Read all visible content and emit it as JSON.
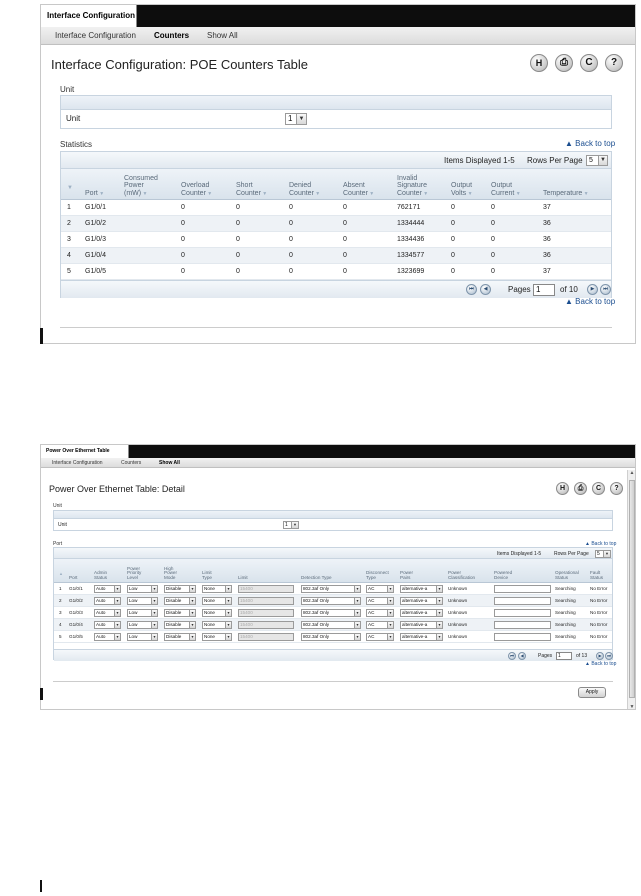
{
  "shot1": {
    "top_tab": "Interface Configuration",
    "subnav": [
      "Interface Configuration",
      "Counters",
      "Show All"
    ],
    "title": "Interface Configuration: POE Counters Table",
    "icons": {
      "save": "H",
      "print": "⎙",
      "refresh": "C",
      "help": "?"
    },
    "unit_section": "Unit",
    "unit_label": "Unit",
    "unit_value": "1",
    "stats_section": "Statistics",
    "back_to_top": "Back to top",
    "items_displayed": "Items Displayed 1-5",
    "rows_per_page_label": "Rows Per Page",
    "rows_per_page_value": "5",
    "columns": [
      [
        "",
        "Port"
      ],
      [
        "Consumed",
        "Power",
        "(mW)"
      ],
      [
        "Overload",
        "Counter"
      ],
      [
        "Short",
        "Counter"
      ],
      [
        "Denied",
        "Counter"
      ],
      [
        "Absent",
        "Counter"
      ],
      [
        "Invalid",
        "Signature",
        "Counter"
      ],
      [
        "Output",
        "Volts"
      ],
      [
        "Output",
        "Current"
      ],
      [
        "Temperature"
      ]
    ],
    "rows": [
      [
        "1",
        "G1/0/1",
        "",
        "0",
        "0",
        "0",
        "0",
        "762171",
        "0",
        "0",
        "37"
      ],
      [
        "2",
        "G1/0/2",
        "",
        "0",
        "0",
        "0",
        "0",
        "1334444",
        "0",
        "0",
        "36"
      ],
      [
        "3",
        "G1/0/3",
        "",
        "0",
        "0",
        "0",
        "0",
        "1334436",
        "0",
        "0",
        "36"
      ],
      [
        "4",
        "G1/0/4",
        "",
        "0",
        "0",
        "0",
        "0",
        "1334577",
        "0",
        "0",
        "36"
      ],
      [
        "5",
        "G1/0/5",
        "",
        "0",
        "0",
        "0",
        "0",
        "1323699",
        "0",
        "0",
        "37"
      ]
    ],
    "pages_label": "Pages",
    "page_value": "1",
    "of_pages": "of 10"
  },
  "shot2": {
    "top_tab": "Power Over Ethernet Table",
    "subnav": [
      "Interface Configuration",
      "Counters",
      "Show All"
    ],
    "title": "Power Over Ethernet Table: Detail",
    "icons": {
      "save": "H",
      "print": "⎙",
      "refresh": "C",
      "help": "?"
    },
    "unit_section": "Unit",
    "unit_label": "Unit",
    "unit_value": "1",
    "port_section": "Port",
    "back_to_top": "Back to top",
    "items_displayed": "Items Displayed 1-5",
    "rows_per_page_label": "Rows Per Page",
    "rows_per_page_value": "5",
    "columns": [
      [
        "",
        "Port"
      ],
      [
        "Admin",
        "Status"
      ],
      [
        "Power",
        "Priority",
        "Level"
      ],
      [
        "High",
        "Power",
        "Mode"
      ],
      [
        "Limit",
        "Type"
      ],
      [
        "Limit"
      ],
      [
        "Detection Type"
      ],
      [
        "Disconnect",
        "Type"
      ],
      [
        "Power",
        "Pairs"
      ],
      [
        "Power",
        "Classification"
      ],
      [
        "Powered",
        "Device"
      ],
      [
        "Operational",
        "Status"
      ],
      [
        "Fault",
        "Status"
      ]
    ],
    "rows": [
      {
        "n": "1",
        "port": "G1/0/1",
        "admin": "Auto",
        "priority": "Low",
        "high": "Disable",
        "ltype": "None",
        "limit": "15400",
        "detect": "802.3af Only",
        "disc": "AC",
        "pairs": "alternative-a",
        "cls": "Unknown",
        "op": "Searching",
        "fault": "No Error"
      },
      {
        "n": "2",
        "port": "G1/0/2",
        "admin": "Auto",
        "priority": "Low",
        "high": "Disable",
        "ltype": "None",
        "limit": "15400",
        "detect": "802.3af Only",
        "disc": "AC",
        "pairs": "alternative-a",
        "cls": "Unknown",
        "op": "Searching",
        "fault": "No Error"
      },
      {
        "n": "3",
        "port": "G1/0/3",
        "admin": "Auto",
        "priority": "Low",
        "high": "Disable",
        "ltype": "None",
        "limit": "15400",
        "detect": "802.3af Only",
        "disc": "AC",
        "pairs": "alternative-a",
        "cls": "Unknown",
        "op": "Searching",
        "fault": "No Error"
      },
      {
        "n": "4",
        "port": "G1/0/4",
        "admin": "Auto",
        "priority": "Low",
        "high": "Disable",
        "ltype": "None",
        "limit": "15400",
        "detect": "802.3af Only",
        "disc": "AC",
        "pairs": "alternative-a",
        "cls": "Unknown",
        "op": "Searching",
        "fault": "No Error"
      },
      {
        "n": "5",
        "port": "G1/0/5",
        "admin": "Auto",
        "priority": "Low",
        "high": "Disable",
        "ltype": "None",
        "limit": "15400",
        "detect": "802.3af Only",
        "disc": "AC",
        "pairs": "alternative-a",
        "cls": "Unknown",
        "op": "Searching",
        "fault": "No Error"
      }
    ],
    "pages_label": "Pages",
    "page_value": "1",
    "of_pages": "of 13",
    "apply_label": "Apply"
  }
}
